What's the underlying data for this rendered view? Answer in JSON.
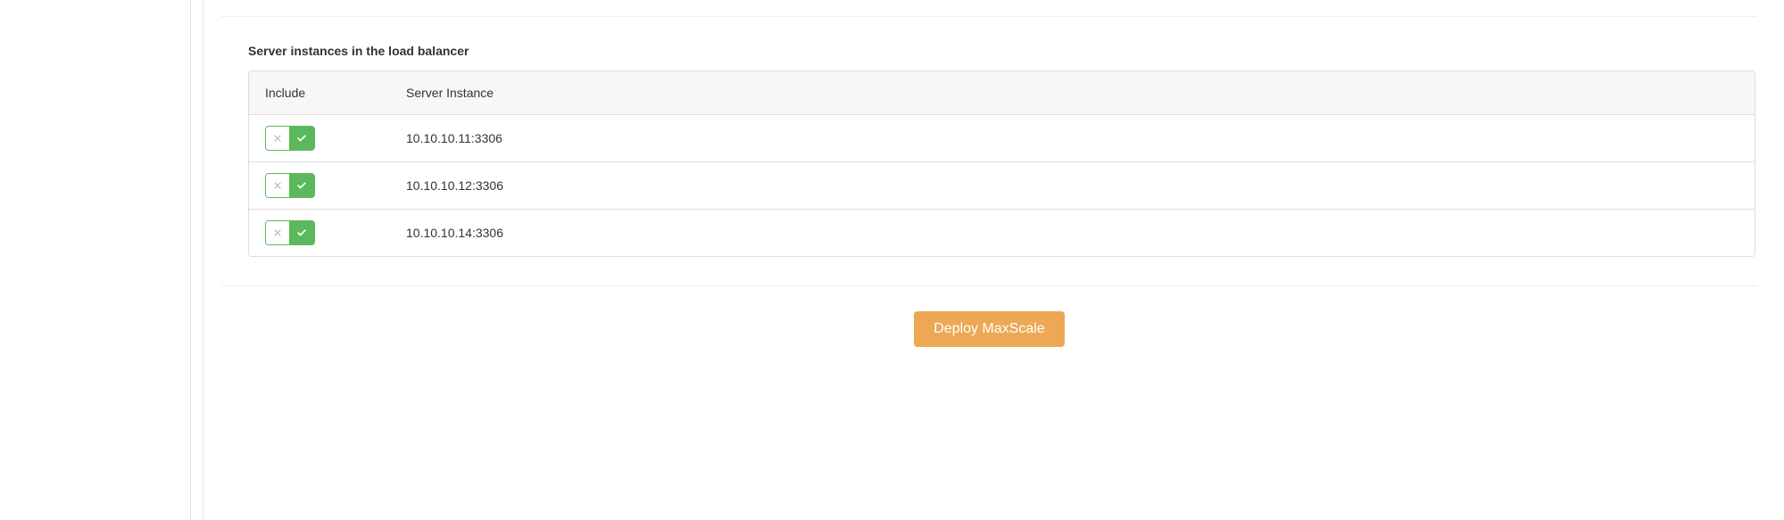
{
  "section": {
    "title": "Server instances in the load balancer"
  },
  "table": {
    "headers": {
      "include": "Include",
      "instance": "Server Instance"
    },
    "rows": [
      {
        "instance": "10.10.10.11:3306",
        "included": true
      },
      {
        "instance": "10.10.10.12:3306",
        "included": true
      },
      {
        "instance": "10.10.10.14:3306",
        "included": true
      }
    ]
  },
  "actions": {
    "deploy_label": "Deploy MaxScale"
  }
}
